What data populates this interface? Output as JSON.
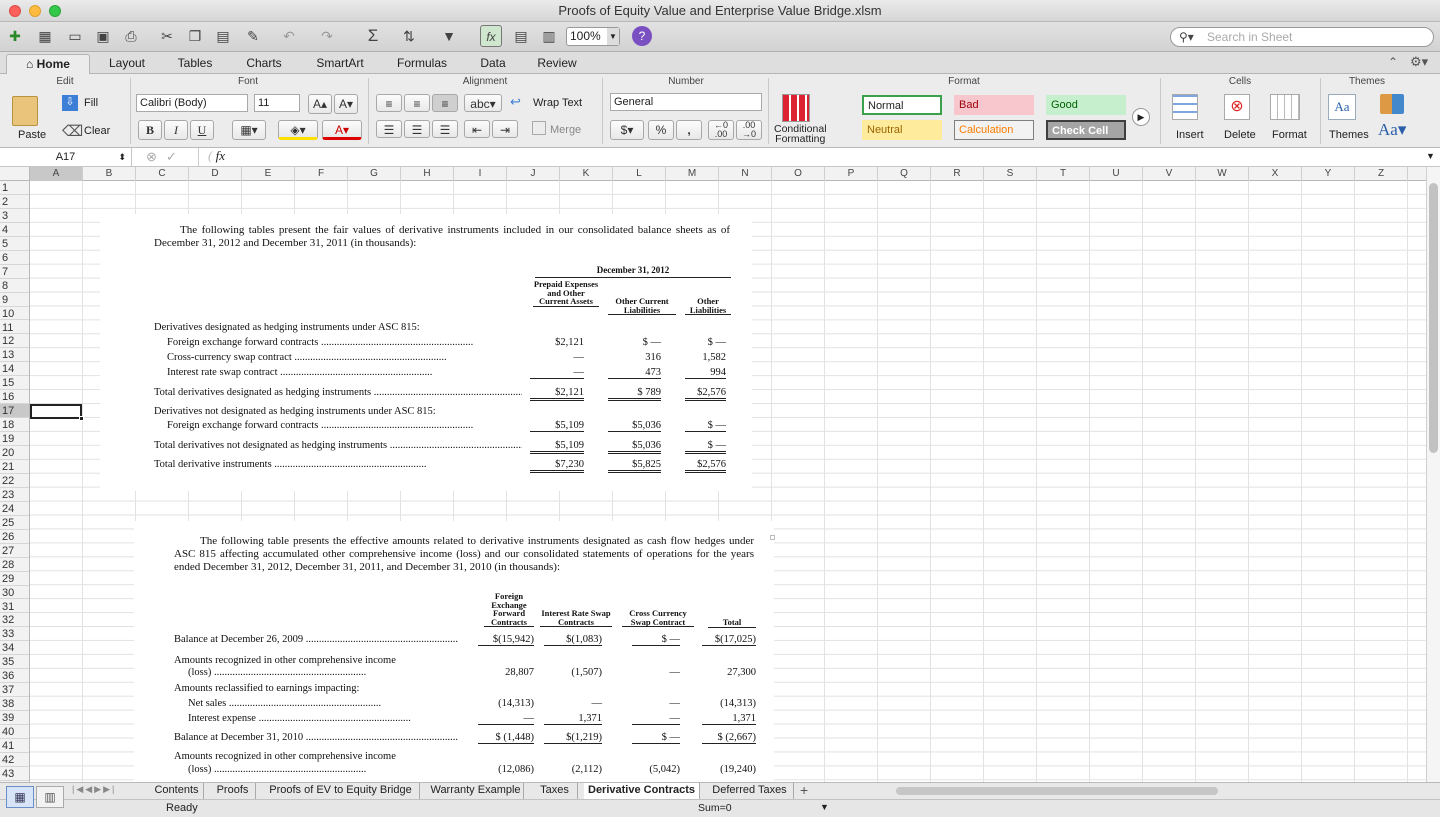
{
  "window": {
    "title": "Proofs of Equity Value and Enterprise Value Bridge.xlsm"
  },
  "toolbar": {
    "zoom": "100%",
    "search_placeholder": "Search in Sheet"
  },
  "ribbon_tabs": [
    "Home",
    "Layout",
    "Tables",
    "Charts",
    "SmartArt",
    "Formulas",
    "Data",
    "Review"
  ],
  "groups": {
    "edit": "Edit",
    "font": "Font",
    "alignment": "Alignment",
    "number": "Number",
    "format": "Format",
    "cells": "Cells",
    "themes": "Themes"
  },
  "edit": {
    "paste": "Paste",
    "fill": "Fill",
    "clear": "Clear"
  },
  "font": {
    "name": "Calibri (Body)",
    "size": "11",
    "bold": "B",
    "italic": "I",
    "underline": "U"
  },
  "alignment": {
    "wrap": "Wrap Text",
    "merge": "Merge",
    "abc": "abc"
  },
  "number": {
    "format": "General",
    "percent": "%",
    "comma": ","
  },
  "format": {
    "conditional": "Conditional",
    "formatting": "Formatting",
    "styles": [
      {
        "label": "Normal",
        "bg": "#ffffff",
        "fg": "#000000",
        "border": "#3aa04a"
      },
      {
        "label": "Bad",
        "bg": "#f8c7cd",
        "fg": "#9c0006",
        "border": "#f8c7cd"
      },
      {
        "label": "Good",
        "bg": "#c6efce",
        "fg": "#006100",
        "border": "#c6efce"
      },
      {
        "label": "Neutral",
        "bg": "#ffeb9c",
        "fg": "#9c6500",
        "border": "#ffeb9c"
      },
      {
        "label": "Calculation",
        "bg": "#f2f2f2",
        "fg": "#fa7d00",
        "border": "#7f7f7f"
      },
      {
        "label": "Check Cell",
        "bg": "#a5a5a5",
        "fg": "#ffffff",
        "border": "#3f3f3f"
      }
    ]
  },
  "cells": {
    "insert": "Insert",
    "delete": "Delete",
    "format": "Format"
  },
  "themes": {
    "label": "Themes",
    "aa": "Aa"
  },
  "formula_bar": {
    "cell_ref": "A17",
    "fx": "fx",
    "value": ""
  },
  "columns": [
    "A",
    "B",
    "C",
    "D",
    "E",
    "F",
    "G",
    "H",
    "I",
    "J",
    "K",
    "L",
    "M",
    "N",
    "O",
    "P",
    "Q",
    "R",
    "S",
    "T",
    "U",
    "V",
    "W",
    "X",
    "Y",
    "Z"
  ],
  "rows": [
    "1",
    "2",
    "3",
    "4",
    "5",
    "6",
    "7",
    "8",
    "9",
    "10",
    "11",
    "12",
    "13",
    "14",
    "15",
    "16",
    "17",
    "18",
    "19",
    "20",
    "21",
    "22",
    "23",
    "24",
    "25",
    "26",
    "27",
    "28",
    "29",
    "30",
    "31",
    "32",
    "33",
    "34",
    "35",
    "36",
    "37",
    "38",
    "39",
    "40",
    "41",
    "42",
    "43"
  ],
  "table1": {
    "intro": "The following tables present the fair values of derivative instruments included in our consolidated balance sheets as of December 31, 2012 and December 31, 2011 (in thousands):",
    "period": "December 31, 2012",
    "col_heads": [
      "Prepaid Expenses and Other Current Assets",
      "Other Current Liabilities",
      "Other Liabilities"
    ],
    "section1": "Derivatives designated as hedging instruments under ASC 815:",
    "rows": [
      {
        "label": "Foreign exchange forward contracts",
        "c1": "$2,121",
        "c2": "$  —",
        "c3": "$  —"
      },
      {
        "label": "Cross-currency swap contract",
        "c1": "—",
        "c2": "316",
        "c3": "1,582"
      },
      {
        "label": "Interest rate swap contract",
        "c1": "—",
        "c2": "473",
        "c3": "994"
      },
      {
        "label": "Total derivatives designated as hedging instruments",
        "c1": "$2,121",
        "c2": "$  789",
        "c3": "$2,576"
      },
      {
        "label": "Foreign exchange forward contracts",
        "c1": "$5,109",
        "c2": "$5,036",
        "c3": "$  —"
      },
      {
        "label": "Total derivatives not designated as hedging instruments",
        "c1": "$5,109",
        "c2": "$5,036",
        "c3": "$  —"
      },
      {
        "label": "Total derivative instruments",
        "c1": "$7,230",
        "c2": "$5,825",
        "c3": "$2,576"
      }
    ],
    "section2": "Derivatives not designated as hedging instruments under ASC 815:"
  },
  "table2": {
    "intro": "The following table presents the effective amounts related to derivative instruments designated as cash flow hedges under ASC 815 affecting accumulated other comprehensive income (loss) and our consolidated statements of operations for the years ended December 31, 2012, December 31, 2011, and December 31, 2010 (in thousands):",
    "col_heads": [
      "Foreign Exchange Forward Contracts",
      "Interest Rate Swap Contracts",
      "Cross Currency Swap Contract",
      "Total"
    ],
    "rows": [
      {
        "label": "Balance at December 26, 2009",
        "c1": "$(15,942)",
        "c2": "$(1,083)",
        "c3": "$  —",
        "c4": "$(17,025)"
      },
      {
        "label": "Amounts recognized in other comprehensive income",
        "label2": "(loss)",
        "c1": "28,807",
        "c2": "(1,507)",
        "c3": "—",
        "c4": "27,300"
      },
      {
        "label": "Amounts reclassified to earnings impacting:"
      },
      {
        "label": "Net sales",
        "c1": "(14,313)",
        "c2": "—",
        "c3": "—",
        "c4": "(14,313)"
      },
      {
        "label": "Interest expense",
        "c1": "—",
        "c2": "1,371",
        "c3": "—",
        "c4": "1,371"
      },
      {
        "label": "Balance at December 31, 2010",
        "c1": "$ (1,448)",
        "c2": "$(1,219)",
        "c3": "$  —",
        "c4": "$ (2,667)"
      },
      {
        "label": "Amounts recognized in other comprehensive income",
        "label2": "(loss)",
        "c1": "(12,086)",
        "c2": "(2,112)",
        "c3": "(5,042)",
        "c4": "(19,240)"
      }
    ]
  },
  "sheet_tabs": [
    "Contents",
    "Proofs",
    "Proofs of EV to Equity Bridge",
    "Warranty Example",
    "Taxes",
    "Derivative Contracts",
    "Deferred Taxes"
  ],
  "active_tab": "Derivative Contracts",
  "status": {
    "ready": "Ready",
    "sum": "Sum=0"
  }
}
